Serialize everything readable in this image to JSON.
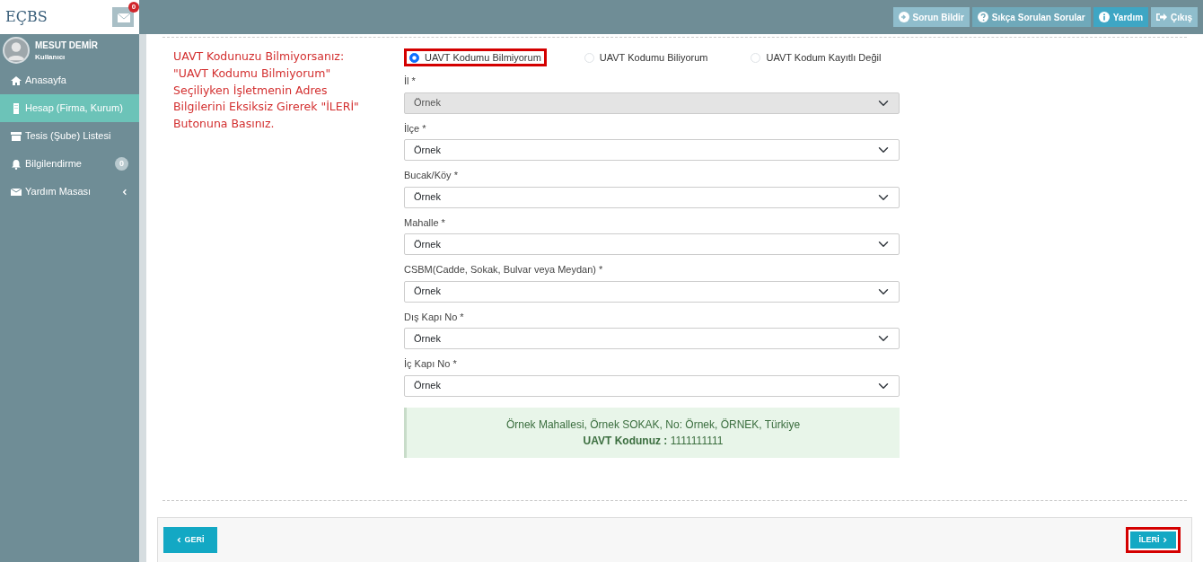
{
  "logo": {
    "text": "EÇBS"
  },
  "mail": {
    "badge": "0"
  },
  "user": {
    "name": "MESUT DEMİR",
    "role": "Kullanıcı"
  },
  "sidebar": {
    "items": [
      {
        "label": "Anasayfa",
        "selected": false
      },
      {
        "label": "Hesap (Firma, Kurum)",
        "selected": true
      },
      {
        "label": "Tesis (Şube) Listesi",
        "selected": false
      },
      {
        "label": "Bilgilendirme",
        "selected": false,
        "badge": "0"
      },
      {
        "label": "Yardım Masası",
        "selected": false
      }
    ]
  },
  "top_buttons": [
    {
      "label": "Sorun Bildir",
      "color": "#8fbdcc"
    },
    {
      "label": "Sıkça Sorulan Sorular",
      "color": "#6fa9ba"
    },
    {
      "label": "Yardım",
      "color": "#3ea6c4"
    },
    {
      "label": "Çıkış",
      "color": "#8fbdcc"
    }
  ],
  "annotation": {
    "text": "UAVT Kodunuzu Bilmiyorsanız: \"UAVT Kodumu Bilmiyorum\" Seçiliyken İşletmenin Adres Bilgilerini Eksiksiz Girerek \"İLERİ\" Butonuna Basınız."
  },
  "radios": [
    {
      "label": "UAVT Kodumu Bilmiyorum",
      "selected": true,
      "highlighted": true
    },
    {
      "label": "UAVT Kodumu Biliyorum",
      "selected": false,
      "highlighted": false
    },
    {
      "label": "UAVT Kodum Kayıtlı Değil",
      "selected": false,
      "highlighted": false
    }
  ],
  "fields": [
    {
      "label": "İl *",
      "value": "Örnek",
      "disabled": true
    },
    {
      "label": "İlçe *",
      "value": "Örnek",
      "disabled": false
    },
    {
      "label": "Bucak/Köy *",
      "value": "Örnek",
      "disabled": false
    },
    {
      "label": "Mahalle *",
      "value": "Örnek",
      "disabled": false
    },
    {
      "label": "CSBM(Cadde, Sokak, Bulvar veya Meydan) *",
      "value": "Örnek",
      "disabled": false
    },
    {
      "label": "Dış Kapı No *",
      "value": "Örnek",
      "disabled": false
    },
    {
      "label": "İç Kapı No *",
      "value": "Örnek",
      "disabled": false
    }
  ],
  "result": {
    "address": "Örnek Mahallesi, Örnek SOKAK, No: Örnek, ÖRNEK, Türkiye",
    "code_label": "UAVT Kodunuz :",
    "code": "1111111111"
  },
  "footer": {
    "back": {
      "label": "GERİ",
      "highlighted": false
    },
    "next": {
      "label": "İLERİ",
      "highlighted": true
    }
  }
}
